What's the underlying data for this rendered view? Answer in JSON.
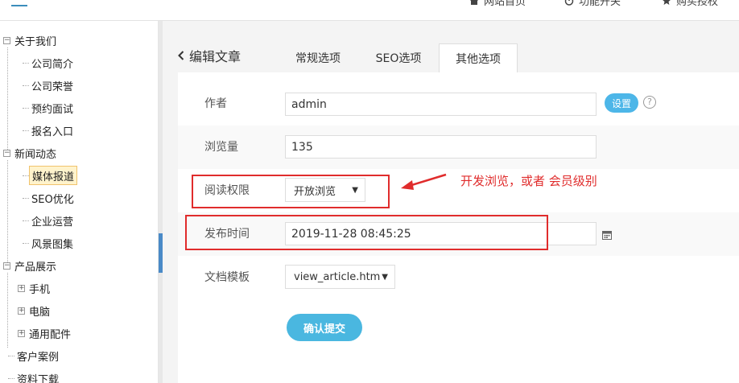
{
  "topbar": {
    "links": [
      {
        "label": "网站首页",
        "icon": "home-icon"
      },
      {
        "label": "功能开关",
        "icon": "power-icon"
      },
      {
        "label": "购买授权",
        "icon": "star-icon"
      }
    ]
  },
  "sidebar": {
    "items": [
      {
        "label": "关于我们",
        "level": 0,
        "toggle": "−"
      },
      {
        "label": "公司简介",
        "level": 1
      },
      {
        "label": "公司荣誉",
        "level": 1
      },
      {
        "label": "预约面试",
        "level": 1
      },
      {
        "label": "报名入口",
        "level": 1
      },
      {
        "label": "新闻动态",
        "level": 0,
        "toggle": "−"
      },
      {
        "label": "媒体报道",
        "level": 1,
        "active": true
      },
      {
        "label": "SEO优化",
        "level": 1
      },
      {
        "label": "企业运营",
        "level": 1
      },
      {
        "label": "风景图集",
        "level": 1
      },
      {
        "label": "产品展示",
        "level": 0,
        "toggle": "−"
      },
      {
        "label": "手机",
        "level": 1,
        "toggle": "+"
      },
      {
        "label": "电脑",
        "level": 1,
        "toggle": "+"
      },
      {
        "label": "通用配件",
        "level": 1,
        "toggle": "+"
      },
      {
        "label": "客户案例",
        "level": 0
      },
      {
        "label": "资料下载",
        "level": 0
      }
    ]
  },
  "header": {
    "back_label": "编辑文章",
    "tabs": [
      "常规选项",
      "SEO选项",
      "其他选项"
    ],
    "active_tab": "其他选项"
  },
  "form": {
    "author_label": "作者",
    "author_value": "admin",
    "setup_button": "设置",
    "views_label": "浏览量",
    "views_value": "135",
    "permission_label": "阅读权限",
    "permission_value": "开放浏览",
    "publish_label": "发布时间",
    "publish_value": "2019-11-28 08:45:25",
    "template_label": "文档模板",
    "template_value": "view_article.htm",
    "submit_label": "确认提交"
  },
  "annotation": {
    "text": "开发浏览，或者 会员级别",
    "color": "#e02c2c"
  },
  "colors": {
    "accent": "#4ab7e0",
    "annotation": "#e02c2c"
  }
}
